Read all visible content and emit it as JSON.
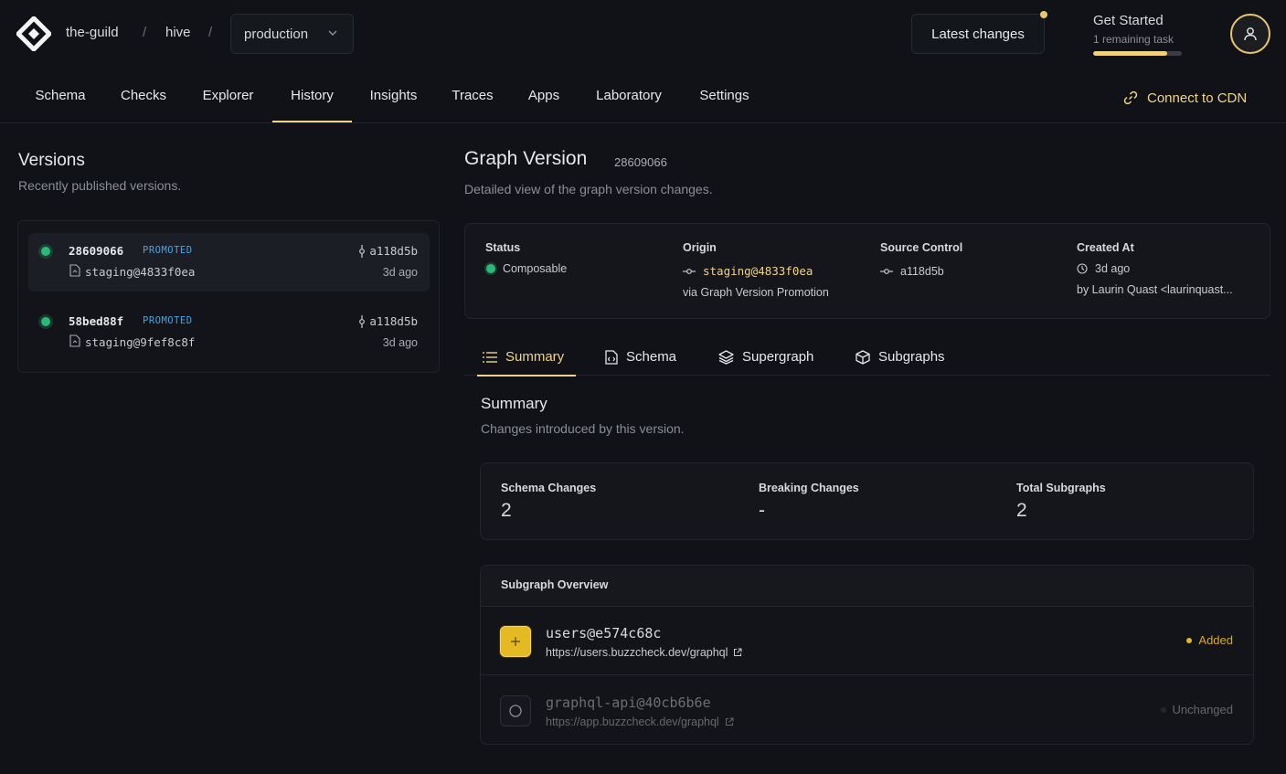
{
  "header": {
    "breadcrumbs": [
      "the-guild",
      "hive"
    ],
    "target": "production",
    "latest_changes": "Latest changes",
    "get_started": {
      "title": "Get Started",
      "subtitle": "1 remaining task",
      "progress": 0.83
    }
  },
  "nav": {
    "tabs": [
      "Schema",
      "Checks",
      "Explorer",
      "History",
      "Insights",
      "Traces",
      "Apps",
      "Laboratory",
      "Settings"
    ],
    "active": "History",
    "cdn": "Connect to CDN"
  },
  "versions": {
    "title": "Versions",
    "subtitle": "Recently published versions.",
    "items": [
      {
        "id": "28609066",
        "badge": "PROMOTED",
        "origin": "staging@4833f0ea",
        "commit": "a118d5b",
        "time": "3d ago"
      },
      {
        "id": "58bed88f",
        "badge": "PROMOTED",
        "origin": "staging@9fef8c8f",
        "commit": "a118d5b",
        "time": "3d ago"
      }
    ]
  },
  "graph_version": {
    "title": "Graph Version",
    "id": "28609066",
    "subtitle": "Detailed view of the graph version changes.",
    "status_label": "Status",
    "status_value": "Composable",
    "origin_label": "Origin",
    "origin_value": "staging@4833f0ea",
    "origin_note": "via Graph Version Promotion",
    "source_label": "Source Control",
    "source_value": "a118d5b",
    "created_label": "Created At",
    "created_value": "3d ago",
    "created_by": "by Laurin Quast <laurinquast..."
  },
  "subtabs": [
    "Summary",
    "Schema",
    "Supergraph",
    "Subgraphs"
  ],
  "summary": {
    "title": "Summary",
    "subtitle": "Changes introduced by this version.",
    "stats": [
      {
        "label": "Schema Changes",
        "value": "2"
      },
      {
        "label": "Breaking Changes",
        "value": "-"
      },
      {
        "label": "Total Subgraphs",
        "value": "2"
      }
    ]
  },
  "overview": {
    "title": "Subgraph Overview",
    "rows": [
      {
        "name": "users@e574c68c",
        "url": "https://users.buzzcheck.dev/graphql",
        "status": "Added"
      },
      {
        "name": "graphql-api@40cb6b6e",
        "url": "https://app.buzzcheck.dev/graphql",
        "status": "Unchanged"
      }
    ]
  },
  "colors": {
    "accent": "#f0d48a",
    "green": "#2db875",
    "promoted": "#4aa3df",
    "added": "#e5b922"
  }
}
